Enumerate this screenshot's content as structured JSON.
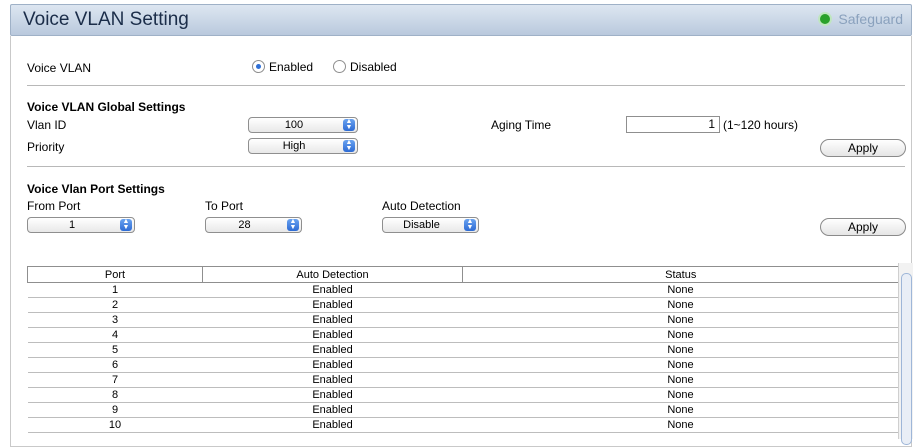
{
  "header": {
    "title": "Voice VLAN Setting",
    "brand": "Safeguard",
    "brand_icon": "status-dot-icon"
  },
  "voice_vlan": {
    "label": "Voice VLAN",
    "enabled_label": "Enabled",
    "disabled_label": "Disabled",
    "selected": "Enabled"
  },
  "global": {
    "heading": "Voice VLAN Global Settings",
    "vlan_id_label": "Vlan ID",
    "vlan_id_value": "100",
    "priority_label": "Priority",
    "priority_value": "High",
    "aging_label": "Aging Time",
    "aging_value": "1",
    "aging_hint": "(1~120 hours)",
    "apply_label": "Apply"
  },
  "port_settings": {
    "heading": "Voice Vlan Port Settings",
    "from_label": "From Port",
    "from_value": "1",
    "to_label": "To Port",
    "to_value": "28",
    "auto_label": "Auto Detection",
    "auto_value": "Disable",
    "apply_label": "Apply"
  },
  "table": {
    "headers": [
      "Port",
      "Auto Detection",
      "Status"
    ],
    "rows": [
      [
        "1",
        "Enabled",
        "None"
      ],
      [
        "2",
        "Enabled",
        "None"
      ],
      [
        "3",
        "Enabled",
        "None"
      ],
      [
        "4",
        "Enabled",
        "None"
      ],
      [
        "5",
        "Enabled",
        "None"
      ],
      [
        "6",
        "Enabled",
        "None"
      ],
      [
        "7",
        "Enabled",
        "None"
      ],
      [
        "8",
        "Enabled",
        "None"
      ],
      [
        "9",
        "Enabled",
        "None"
      ],
      [
        "10",
        "Enabled",
        "None"
      ]
    ]
  }
}
